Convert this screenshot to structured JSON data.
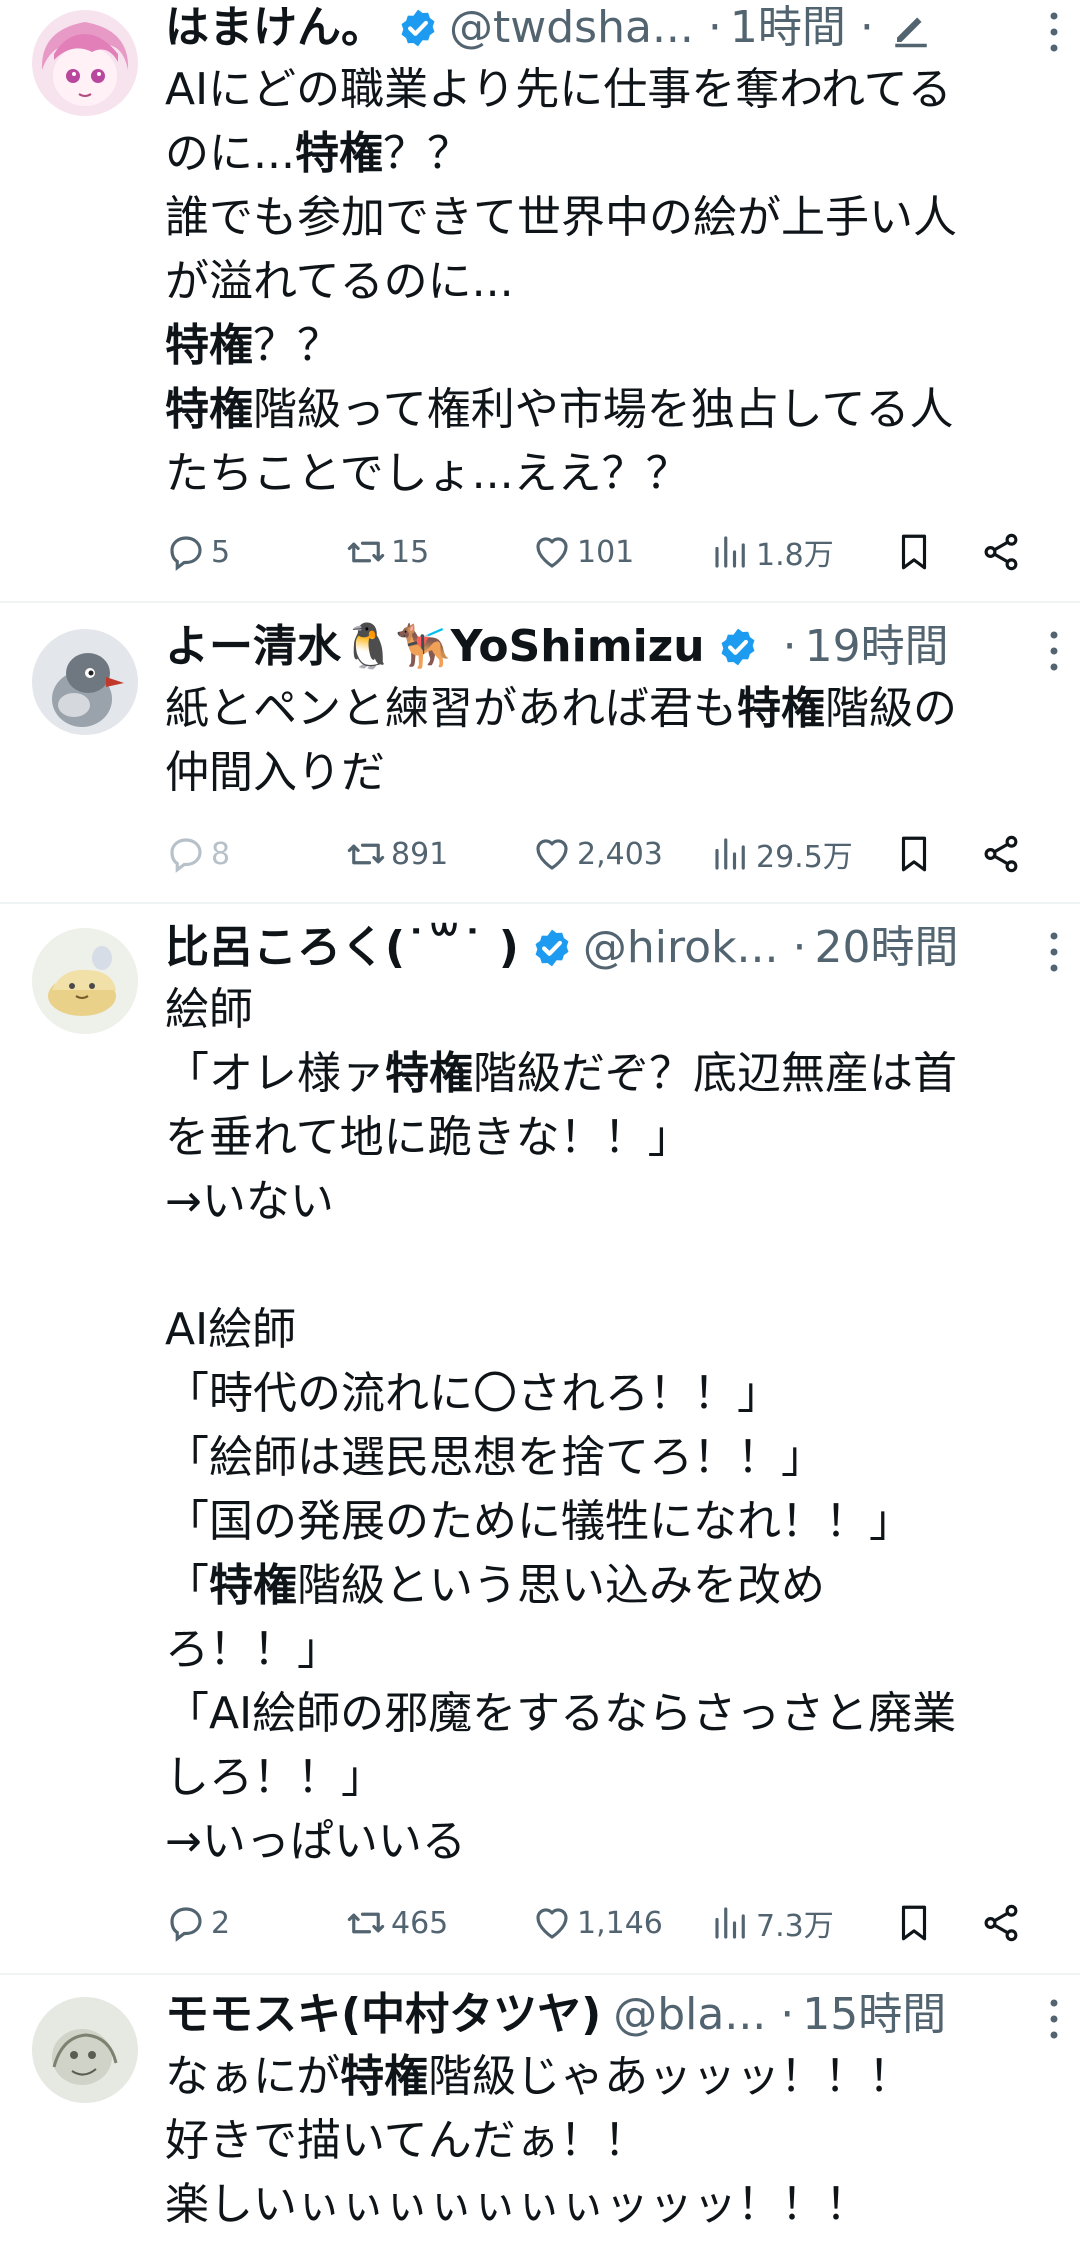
{
  "tweets": [
    {
      "name": "はまけん。",
      "handle": "@twdsha...",
      "time": "1時間",
      "verified": true,
      "body_html": "AIにどの職業より先に仕事を奪われてる\nのに...<b>特権</b>？？\n誰でも参加できて世界中の絵が上手い人\nが溢れてるのに...\n<b>特権</b>？？\n<b>特権</b>階級って権利や市場を独占してる人\nたちことでしょ...ええ？？",
      "replies": "5",
      "retweets": "15",
      "likes": "101",
      "views": "1.8万"
    },
    {
      "name": "よー清水🐧🐕‍🦺YoShimizu",
      "handle": "",
      "time": "19時間",
      "verified": true,
      "body_html": "紙とペンと練習があれば君も<b>特権</b>階級の\n仲間入りだ",
      "replies": "8",
      "retweets": "891",
      "likes": "2,403",
      "views": "29.5万"
    },
    {
      "name": "比呂ころく(˙꒳˙ )",
      "handle": "@hirok...",
      "time": "20時間",
      "verified": true,
      "body_html": "絵師\n「オレ様ァ<b>特権</b>階級だぞ？底辺無産は首\nを垂れて地に跪きな！！」\n→いない\n\nAI絵師\n「時代の流れに〇されろ！！」\n「絵師は選民思想を捨てろ！！」\n「国の発展のために犠牲になれ！！」\n「<b>特権</b>階級という思い込みを改め\nろ！！」\n「AI絵師の邪魔をするならさっさと廃業\nしろ！！」\n→いっぱいいる",
      "replies": "2",
      "retweets": "465",
      "likes": "1,146",
      "views": "7.3万"
    },
    {
      "name": "モモスキ(中村タツヤ)",
      "handle": "@bla...",
      "time": "15時間",
      "verified": false,
      "body_html": "なぁにが<b>特権</b>階級じゃあッッッ！！！\n好きで描いてんだぁ！！\n楽しいぃぃぃぃぃぃぃッッッ！！！",
      "replies": "",
      "retweets": "",
      "likes": "",
      "views": ""
    }
  ],
  "colors": {
    "text": "#0f1419",
    "secondary": "#536471",
    "verified": "#1d9bf0",
    "divider": "#eff3f4"
  }
}
